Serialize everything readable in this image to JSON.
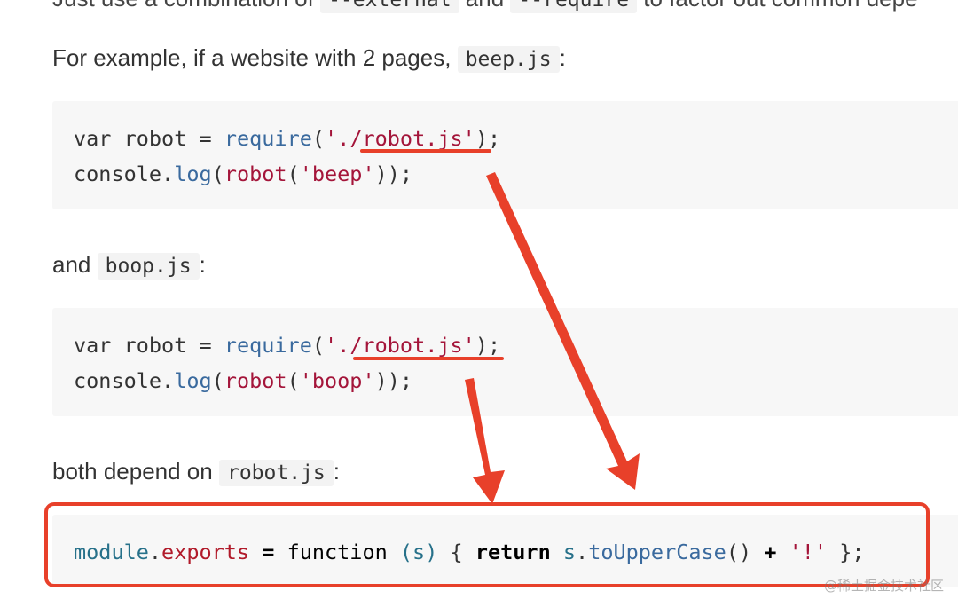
{
  "top_cut_line": {
    "before_a": "Just use a combination of",
    "code_a": "--external",
    "mid": "and",
    "code_b": "--require",
    "after": "to factor out common depe"
  },
  "example_para": {
    "text": "For example, if a website with 2 pages,",
    "code": "beep.js",
    "tail": ":"
  },
  "beep_code": {
    "line1": {
      "kw": "var",
      "name": "robot",
      "op": "=",
      "fn": "require",
      "open": "(",
      "str": "'./robot.js'",
      "close": ");"
    },
    "line2": {
      "obj": "console",
      "dot": ".",
      "method": "log",
      "open": "(",
      "callee": "robot",
      "open2": "(",
      "str": "'beep'",
      "close": "));"
    }
  },
  "and_para": {
    "text": "and",
    "code": "boop.js",
    "tail": ":"
  },
  "boop_code": {
    "line1": {
      "kw": "var",
      "name": "robot",
      "op": "=",
      "fn": "require",
      "open": "(",
      "str": "'./robot.js'",
      "close": ");"
    },
    "line2": {
      "obj": "console",
      "dot": ".",
      "method": "log",
      "open": "(",
      "callee": "robot",
      "open2": "(",
      "str": "'boop'",
      "close": "));"
    }
  },
  "depend_para": {
    "text": "both depend on",
    "code": "robot.js",
    "tail": ":"
  },
  "robot_code": {
    "module": "module",
    "dot": ".",
    "exports": "exports",
    "op": "=",
    "fnkw": "function",
    "params": "(s)",
    "brace_open": "{",
    "ret": "return",
    "s": "s",
    "dot2": ".",
    "method": "toUpperCase",
    "call": "()",
    "plus": "+",
    "str": "'!'",
    "brace_close": "};"
  },
  "watermark": "@稀土掘金技术社区",
  "annotation_color": "#e8402a"
}
